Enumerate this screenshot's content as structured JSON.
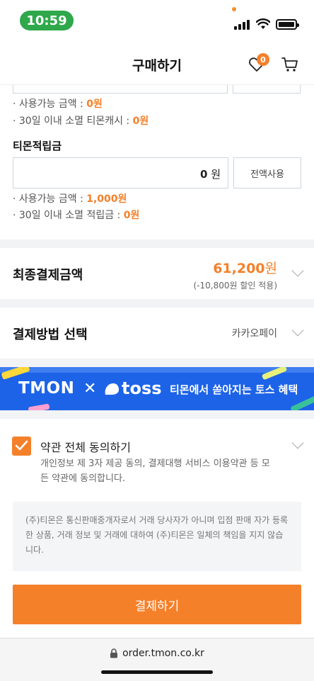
{
  "status_bar": {
    "time": "10:59"
  },
  "header": {
    "title": "구매하기",
    "wishlist_count": "0"
  },
  "tmon_cash": {
    "available_prefix": "· 사용가능 금액 : ",
    "available_value": "0원",
    "expiring_prefix": "· 30일 이내 소멸 티몬캐시 : ",
    "expiring_value": "0원"
  },
  "tmon_points": {
    "label": "티몬적립금",
    "input_value": "0",
    "input_unit": "원",
    "use_all_label": "전액사용",
    "available_prefix": "· 사용가능 금액 : ",
    "available_value": "1,000원",
    "expiring_prefix": "· 30일 이내 소멸 적립금 : ",
    "expiring_value": "0원"
  },
  "final_payment": {
    "label": "최종결제금액",
    "amount": "61,200",
    "unit": "원",
    "discount_note": "(-10,800원 할인 적용)"
  },
  "payment_method": {
    "label": "결제방법 선택",
    "selected": "카카오페이"
  },
  "banner": {
    "brand1": "TMON",
    "separator": "✕",
    "brand2": "toss",
    "text": "티몬에서 쏟아지는 토스 혜택"
  },
  "agreement": {
    "label": "약관 전체 동의하기",
    "checked": true,
    "description": "개인정보 제 3자 제공 동의, 결제대행 서비스 이용약관 등 모든 약관에 동의합니다.",
    "notice": "(주)티몬은 통신판매중개자로서 거래 당사자가 아니며 입점 판매 자가 등록한 상품, 거래 정보 및 거래에 대하여 (주)티몬은 일체의 책임을 지지 않습니다."
  },
  "pay_button": {
    "label": "결제하기"
  },
  "browser": {
    "url": "order.tmon.co.kr"
  },
  "colors": {
    "accent": "#f5802a",
    "banner_blue": "#1d63e8",
    "status_green": "#2ea84a"
  }
}
